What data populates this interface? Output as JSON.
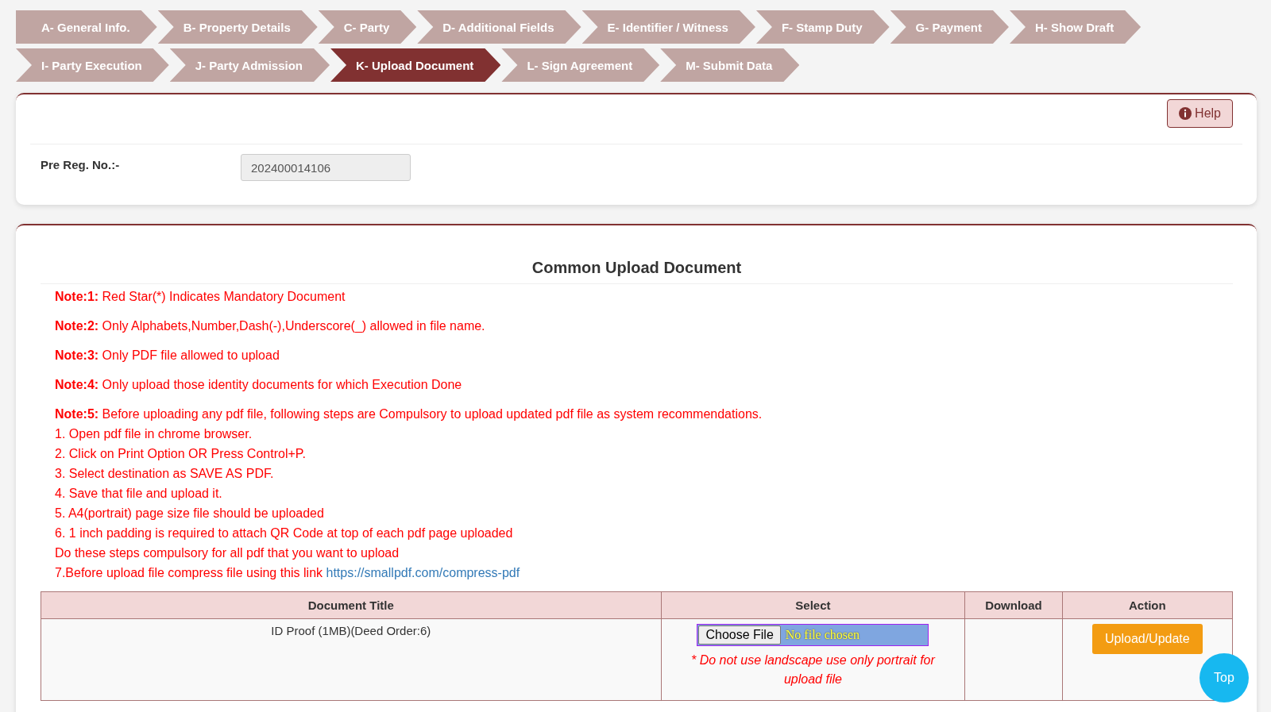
{
  "steps": [
    {
      "label": "A- General Info.",
      "selected": false
    },
    {
      "label": "B- Property Details",
      "selected": false
    },
    {
      "label": "C- Party",
      "selected": false
    },
    {
      "label": "D- Additional Fields",
      "selected": false
    },
    {
      "label": "E- Identifier / Witness",
      "selected": false
    },
    {
      "label": "F- Stamp Duty",
      "selected": false
    },
    {
      "label": "G- Payment",
      "selected": false
    },
    {
      "label": "H- Show Draft",
      "selected": false
    },
    {
      "label": "I- Party Execution",
      "selected": false
    },
    {
      "label": "J- Party Admission",
      "selected": false
    },
    {
      "label": "K- Upload Document",
      "selected": true
    },
    {
      "label": "L- Sign Agreement",
      "selected": false
    },
    {
      "label": "M- Submit Data",
      "selected": false
    }
  ],
  "help_button": "Help",
  "pre_reg": {
    "label": "Pre Reg. No.:-",
    "value": "202400014106"
  },
  "upload_section": {
    "title": "Common Upload Document",
    "notes": [
      {
        "label": "Note:1:",
        "text": "Red Star(*) Indicates Mandatory Document"
      },
      {
        "label": "Note:2:",
        "text": "Only Alphabets,Number,Dash(-),Underscore(_) allowed in file name."
      },
      {
        "label": "Note:3:",
        "text": "Only PDF file allowed to upload"
      },
      {
        "label": "Note:4:",
        "text": "Only upload those identity documents for which Execution Done"
      },
      {
        "label": "Note:5:",
        "text": "Before uploading any pdf file, following steps are Compulsory to upload updated pdf file as system recommendations."
      }
    ],
    "steps": [
      "1. Open pdf file in chrome browser.",
      "2. Click on Print Option OR Press Control+P.",
      "3. Select destination as SAVE AS PDF.",
      "4. Save that file and upload it.",
      "5. A4(portrait) page size file should be uploaded",
      "6. 1 inch padding is required to attach QR Code at top of each pdf page uploaded",
      "Do these steps compulsory for all pdf that you want to upload"
    ],
    "link_line": {
      "text": "7.Before upload file compress file using this link",
      "link": "https://smallpdf.com/compress-pdf"
    },
    "table": {
      "columns": [
        "Document Title",
        "Select",
        "Download",
        "Action"
      ],
      "rows": [
        {
          "title": "ID Proof (1MB)(Deed Order:6)",
          "choose_button": "Choose File",
          "file_status": "No file chosen",
          "warning": "* Do not use landscape use only portrait for upload file",
          "action": "Upload/Update"
        }
      ]
    }
  },
  "top_button": "Top"
}
